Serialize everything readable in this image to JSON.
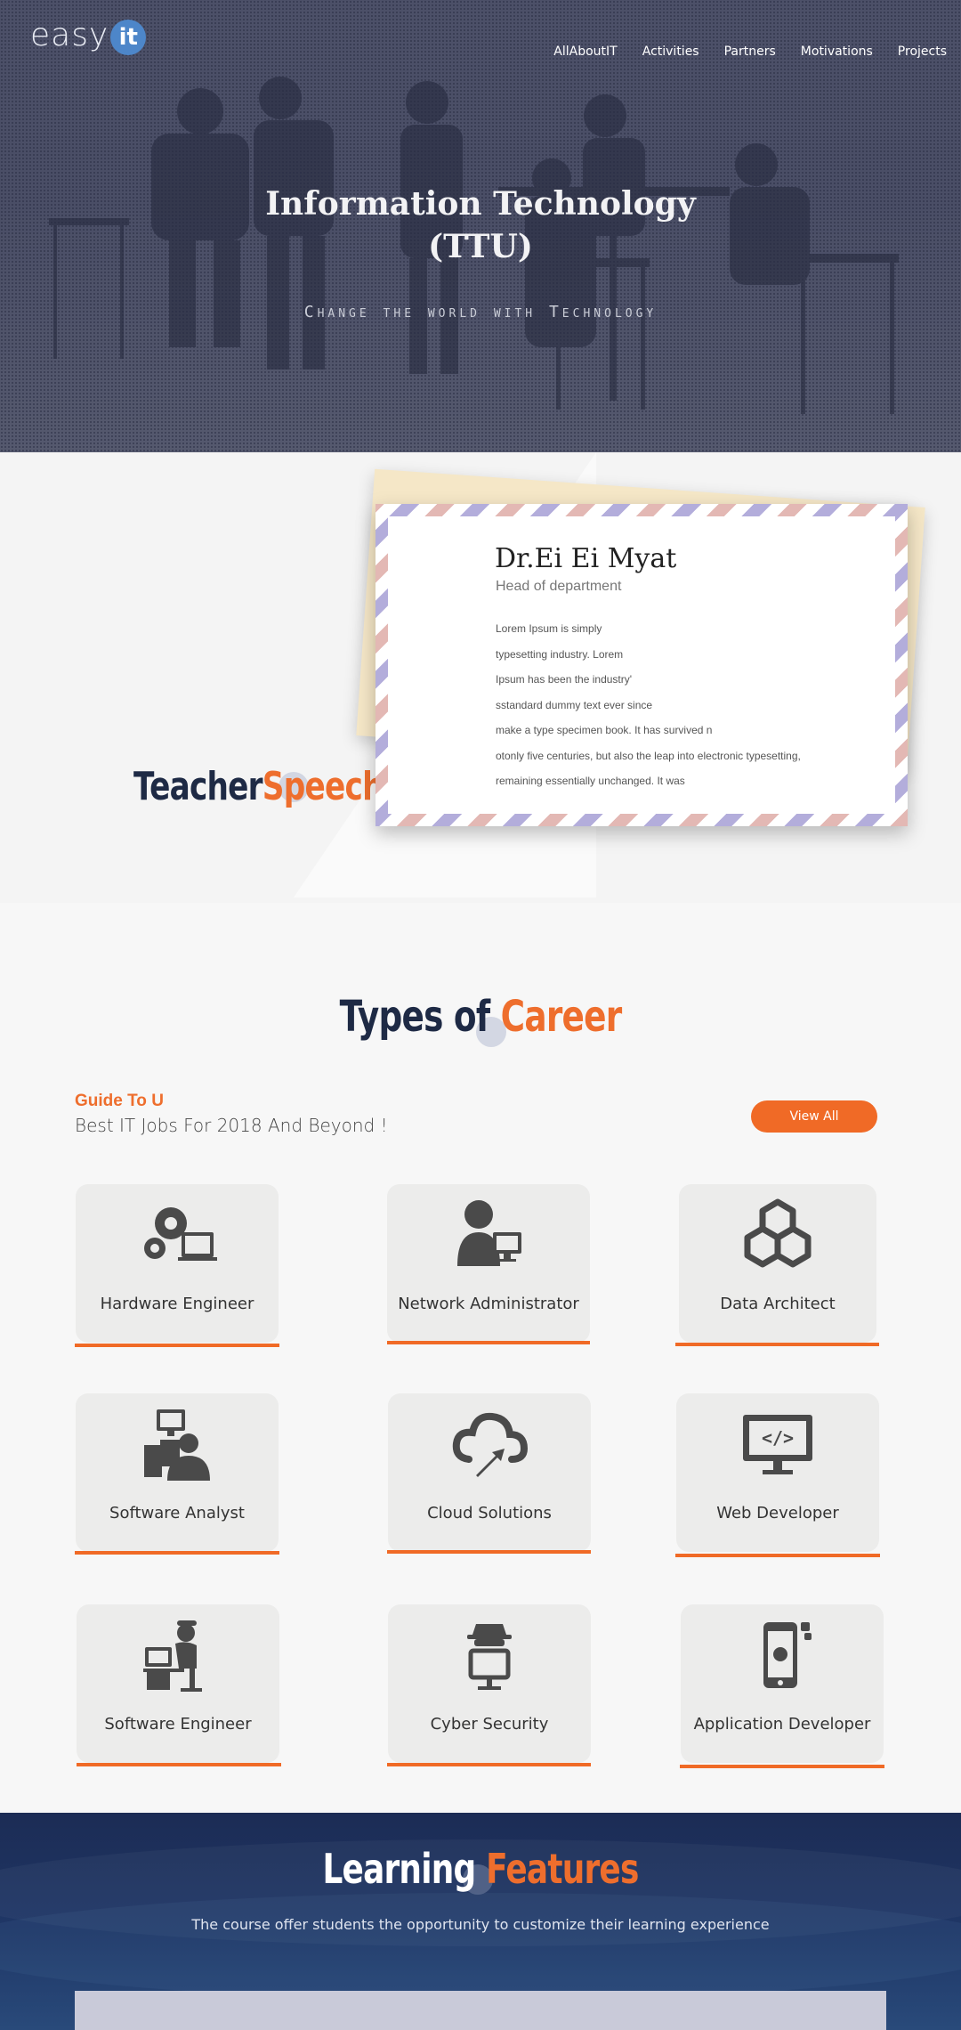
{
  "header": {
    "logo_text": "easy",
    "logo_badge": "it",
    "nav": [
      "AllAboutIT",
      "Activities",
      "Partners",
      "Motivations",
      "Projects"
    ]
  },
  "hero": {
    "title_line1": "Information Technology",
    "title_line2": "(TTU)",
    "subtitle": "Change the world with Technology"
  },
  "teacher": {
    "heading_part1": "Teacher",
    "heading_part2": "Speech",
    "name": "Dr.Ei Ei Myat",
    "role": "Head of department",
    "body_lines": [
      "Lorem Ipsum is simply",
      "typesetting industry. Lorem",
      "Ipsum has been the industry'",
      "sstandard dummy text ever since",
      "make a type specimen book. It has survived n",
      "otonly five centuries, but also the leap into electronic typesetting,",
      "remaining essentially unchanged. It was"
    ]
  },
  "career": {
    "heading_part1": "Types of",
    "heading_part2": "Career",
    "guide_label": "Guide To U",
    "guide_sub": "Best IT Jobs For 2018 And Beyond !",
    "view_all_label": "View All",
    "cards": [
      {
        "label": "Hardware Engineer",
        "icon": "hardware-engineer-icon"
      },
      {
        "label": "Network Administrator",
        "icon": "network-administrator-icon"
      },
      {
        "label": "Data Architect",
        "icon": "data-architect-icon"
      },
      {
        "label": "Software Analyst",
        "icon": "software-analyst-icon"
      },
      {
        "label": "Cloud Solutions",
        "icon": "cloud-solutions-icon"
      },
      {
        "label": "Web Developer",
        "icon": "web-developer-icon"
      },
      {
        "label": "Software Engineer",
        "icon": "software-engineer-icon"
      },
      {
        "label": "Cyber Security",
        "icon": "cyber-security-icon"
      },
      {
        "label": "Application Developer",
        "icon": "application-developer-icon"
      }
    ]
  },
  "learning": {
    "heading_part1": "Learning",
    "heading_part2": "Features",
    "subtitle": "The course offer students the opportunity to customize their learning experience"
  },
  "colors": {
    "accent": "#f06a26",
    "navy": "#1e2a45",
    "hero_overlay": "#4c5068"
  }
}
